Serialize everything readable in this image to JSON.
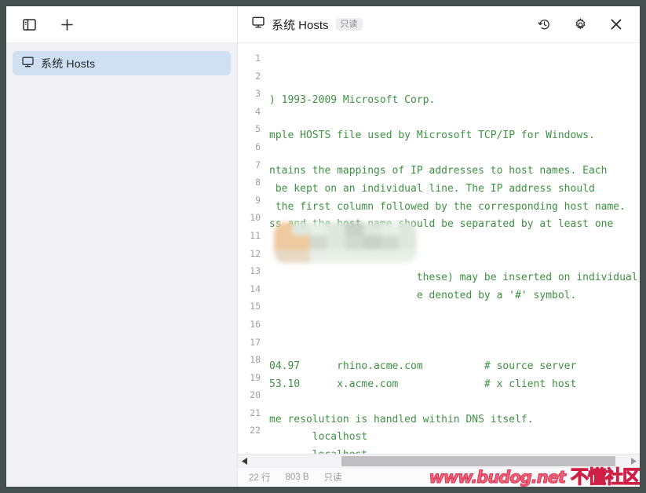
{
  "window": {
    "frame_color": "#46504f",
    "background": "#ffffff"
  },
  "sidebar": {
    "toolbar": {
      "toggle_panel_label": "panel-toggle",
      "add_label": "+"
    },
    "items": [
      {
        "label": "系统 Hosts",
        "icon": "monitor-icon",
        "selected": true
      }
    ]
  },
  "main": {
    "header": {
      "icon": "monitor-icon",
      "title": "系统 Hosts",
      "badge": "只读",
      "actions": [
        {
          "name": "history-icon",
          "label": "history"
        },
        {
          "name": "gear-icon",
          "label": "settings"
        },
        {
          "name": "close-icon",
          "label": "close"
        }
      ]
    },
    "editor": {
      "syntax_color": "#3f9142",
      "line_numbers": [
        "1",
        "2",
        "3",
        "4",
        "5",
        "6",
        "7",
        "8",
        "9",
        "10",
        "11",
        "12",
        "13",
        "14",
        "15",
        "16",
        "17",
        "18",
        "19",
        "20",
        "21",
        "22"
      ],
      "lines": [
        ") 1993-2009 Microsoft Corp.",
        "",
        "mple HOSTS file used by Microsoft TCP/IP for Windows.",
        "",
        "ntains the mappings of IP addresses to host names. Each",
        " be kept on an individual line. The IP address should",
        " the first column followed by the corresponding host name.",
        "ss and the host name should be separated by at least one",
        "",
        "",
        "                        these) may be inserted on individual",
        "                        e denoted by a '#' symbol.",
        "",
        "",
        "",
        "04.97      rhino.acme.com          # source server",
        "53.10      x.acme.com              # x client host",
        "",
        "me resolution is handled within DNS itself.",
        "       localhost",
        "       localhost",
        ""
      ],
      "censored_region": {
        "present": true,
        "description": "mosaic-blur-block",
        "colors": [
          "#efc79a",
          "#e7d7c2",
          "#cfd8cf",
          "#dde7dc",
          "#e8f0e7",
          "#c6d0c7"
        ]
      }
    },
    "scrollbar": {
      "orientation": "horizontal",
      "left_arrow": "◀",
      "right_arrow": "▶",
      "thumb_position_percent": 24
    },
    "statusbar": {
      "lines": "22 行",
      "size": "803 B",
      "mode": "只读"
    }
  },
  "watermark": {
    "url": "www.budog.net",
    "text": "不懂社区",
    "color": "#f05070"
  }
}
